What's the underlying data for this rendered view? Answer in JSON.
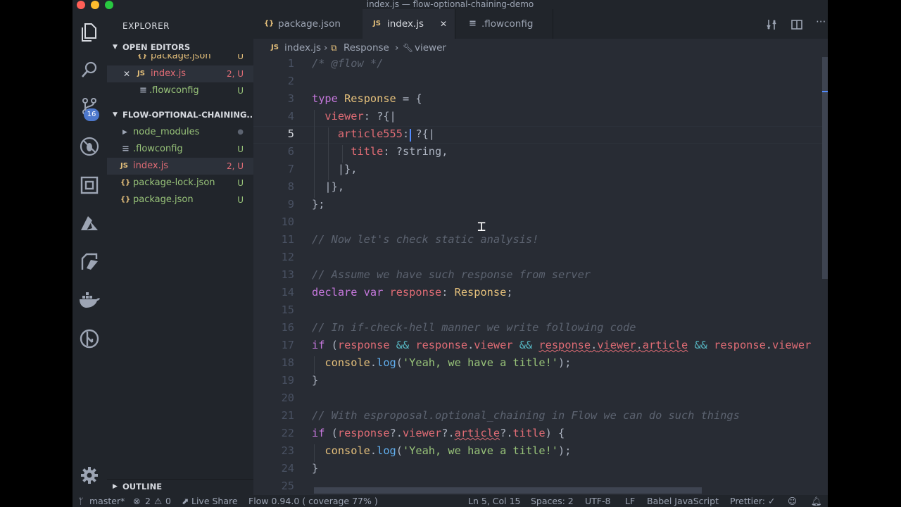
{
  "window": {
    "title": "index.js — flow-optional-chaining-demo"
  },
  "activity_bar": {
    "scm_badge": "16"
  },
  "sidebar": {
    "title": "EXPLORER",
    "open_editors": {
      "label": "OPEN EDITORS",
      "items": [
        {
          "name": "package.json",
          "status": "U",
          "icon": "{}"
        },
        {
          "name": "index.js",
          "status": "2, U",
          "icon": "JS"
        },
        {
          "name": ".flowconfig",
          "status": "U",
          "icon": "≡"
        }
      ]
    },
    "project": {
      "label": "FLOW-OPTIONAL-CHAINING...",
      "items": [
        {
          "name": "node_modules",
          "status": "●"
        },
        {
          "name": ".flowconfig",
          "status": "U",
          "icon": "≡"
        },
        {
          "name": "index.js",
          "status": "2, U",
          "icon": "JS"
        },
        {
          "name": "package-lock.json",
          "status": "U",
          "icon": "{}"
        },
        {
          "name": "package.json",
          "status": "U",
          "icon": "{}"
        }
      ]
    },
    "outline": {
      "label": "OUTLINE"
    }
  },
  "tabs": [
    {
      "label": "package.json",
      "icon": "{}"
    },
    {
      "label": "index.js",
      "icon": "JS",
      "active": true,
      "close": "✕"
    },
    {
      "label": ".flowconfig",
      "icon": "≡"
    }
  ],
  "breadcrumb": {
    "file": "index.js",
    "type": "Response",
    "prop": "viewer",
    "sep": "›"
  },
  "editor": {
    "current_line": 5,
    "lines": [
      [
        {
          "c": "c-c",
          "t": "/* @flow */"
        }
      ],
      [],
      [
        {
          "c": "c-k",
          "t": "type "
        },
        {
          "c": "c-t",
          "t": "Response"
        },
        {
          "c": "c-d",
          "t": " = {"
        }
      ],
      [
        {
          "c": "c-d",
          "t": "  "
        },
        {
          "c": "c-p",
          "t": "viewer"
        },
        {
          "c": "c-d",
          "t": ": ?{|"
        }
      ],
      [
        {
          "c": "c-d",
          "t": "    "
        },
        {
          "c": "c-p",
          "t": "article555"
        },
        {
          "c": "c-d",
          "t": ": ?{|"
        }
      ],
      [
        {
          "c": "c-d",
          "t": "      "
        },
        {
          "c": "c-p",
          "t": "title"
        },
        {
          "c": "c-d",
          "t": ": ?string,"
        }
      ],
      [
        {
          "c": "c-d",
          "t": "    |},"
        }
      ],
      [
        {
          "c": "c-d",
          "t": "  |},"
        }
      ],
      [
        {
          "c": "c-d",
          "t": "};"
        }
      ],
      [],
      [
        {
          "c": "c-c",
          "t": "// Now let's check static analysis!"
        }
      ],
      [],
      [
        {
          "c": "c-c",
          "t": "// Assume we have such response from server"
        }
      ],
      [
        {
          "c": "c-k",
          "t": "declare var "
        },
        {
          "c": "c-p",
          "t": "response"
        },
        {
          "c": "c-d",
          "t": ": "
        },
        {
          "c": "c-t",
          "t": "Response"
        },
        {
          "c": "c-d",
          "t": ";"
        }
      ],
      [],
      [
        {
          "c": "c-c",
          "t": "// In if-check-hell manner we write following code"
        }
      ],
      [
        {
          "c": "c-k",
          "t": "if "
        },
        {
          "c": "c-d",
          "t": "("
        },
        {
          "c": "c-p",
          "t": "response"
        },
        {
          "c": "c-o",
          "t": " && "
        },
        {
          "c": "c-p",
          "t": "response"
        },
        {
          "c": "c-d",
          "t": "."
        },
        {
          "c": "c-p",
          "t": "viewer"
        },
        {
          "c": "c-o",
          "t": " && "
        },
        {
          "c": "c-p sq",
          "t": "response"
        },
        {
          "c": "c-d sq",
          "t": "."
        },
        {
          "c": "c-p sq",
          "t": "viewer"
        },
        {
          "c": "c-d sq",
          "t": "."
        },
        {
          "c": "c-p sq",
          "t": "article"
        },
        {
          "c": "c-o",
          "t": " && "
        },
        {
          "c": "c-p",
          "t": "response"
        },
        {
          "c": "c-d",
          "t": "."
        },
        {
          "c": "c-p",
          "t": "viewer"
        }
      ],
      [
        {
          "c": "c-d",
          "t": "  "
        },
        {
          "c": "c-t",
          "t": "console"
        },
        {
          "c": "c-d",
          "t": "."
        },
        {
          "c": "c-f",
          "t": "log"
        },
        {
          "c": "c-d",
          "t": "("
        },
        {
          "c": "c-s",
          "t": "'Yeah, we have a title!'"
        },
        {
          "c": "c-d",
          "t": ");"
        }
      ],
      [
        {
          "c": "c-d",
          "t": "}"
        }
      ],
      [],
      [
        {
          "c": "c-c",
          "t": "// With esproposal.optional_chaining in Flow we can do such things"
        }
      ],
      [
        {
          "c": "c-k",
          "t": "if "
        },
        {
          "c": "c-d",
          "t": "("
        },
        {
          "c": "c-p",
          "t": "response"
        },
        {
          "c": "c-d",
          "t": "?."
        },
        {
          "c": "c-p",
          "t": "viewer"
        },
        {
          "c": "c-d",
          "t": "?."
        },
        {
          "c": "c-p sq",
          "t": "article"
        },
        {
          "c": "c-d",
          "t": "?."
        },
        {
          "c": "c-p",
          "t": "title"
        },
        {
          "c": "c-d",
          "t": ") {"
        }
      ],
      [
        {
          "c": "c-d",
          "t": "  "
        },
        {
          "c": "c-t",
          "t": "console"
        },
        {
          "c": "c-d",
          "t": "."
        },
        {
          "c": "c-f",
          "t": "log"
        },
        {
          "c": "c-d",
          "t": "("
        },
        {
          "c": "c-s",
          "t": "'Yeah, we have a title!'"
        },
        {
          "c": "c-d",
          "t": ");"
        }
      ],
      [
        {
          "c": "c-d",
          "t": "}"
        }
      ],
      []
    ]
  },
  "status_bar": {
    "branch": "master*",
    "errors": "2",
    "warnings": "0",
    "live_share": "Live Share",
    "flow": "Flow 0.94.0 ( coverage 77% )",
    "position": "Ln 5, Col 15",
    "spaces": "Spaces: 2",
    "encoding": "UTF-8",
    "eol": "LF",
    "language": "Babel JavaScript",
    "formatter": "Prettier: ✓"
  }
}
